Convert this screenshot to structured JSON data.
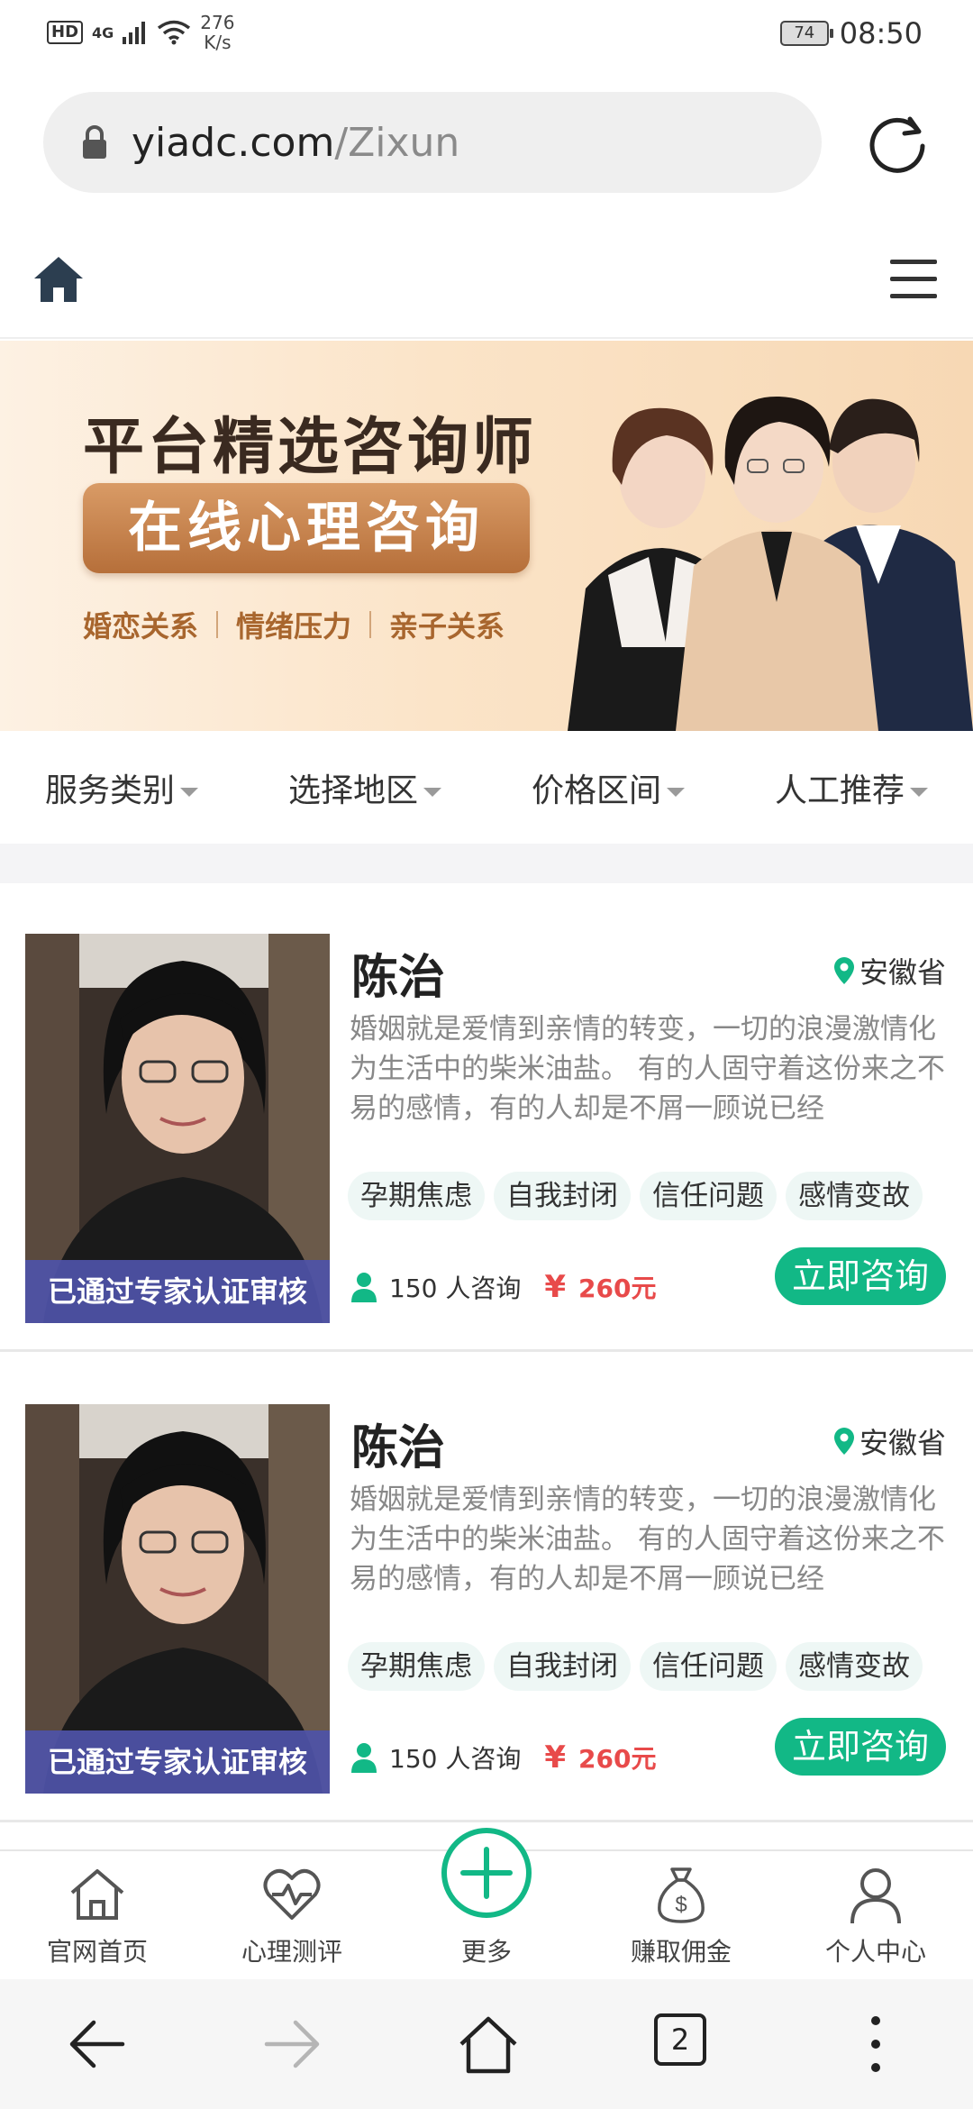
{
  "status_bar": {
    "signal_label": "HD",
    "network": "4G",
    "speed_value": "276",
    "speed_unit": "K/s",
    "battery": "74",
    "time": "08:50"
  },
  "browser": {
    "url_domain": "yiadc.com",
    "url_path": "/Zixun"
  },
  "banner": {
    "title": "平台精选咨询师",
    "subtitle": "在线心理咨询",
    "tags": [
      "婚恋关系",
      "情绪压力",
      "亲子关系"
    ]
  },
  "filters": [
    "服务类别",
    "选择地区",
    "价格区间",
    "人工推荐"
  ],
  "cards": [
    {
      "name": "陈治",
      "location": "安徽省",
      "verified": "已通过专家认证审核",
      "description": "婚姻就是爱情到亲情的转变，一切的浪漫激情化为生活中的柴米油盐。 有的人固守着这份来之不易的感情，有的人却是不屑一顾说已经",
      "tags": [
        "孕期焦虑",
        "自我封闭",
        "信任问题",
        "感情变故"
      ],
      "consult_count": "150 人咨询",
      "price_symbol": "¥",
      "price": "260元",
      "button": "立即咨询"
    },
    {
      "name": "陈治",
      "location": "安徽省",
      "verified": "已通过专家认证审核",
      "description": "婚姻就是爱情到亲情的转变，一切的浪漫激情化为生活中的柴米油盐。 有的人固守着这份来之不易的感情，有的人却是不屑一顾说已经",
      "tags": [
        "孕期焦虑",
        "自我封闭",
        "信任问题",
        "感情变故"
      ],
      "consult_count": "150 人咨询",
      "price_symbol": "¥",
      "price": "260元",
      "button": "立即咨询"
    }
  ],
  "site_nav": [
    {
      "label": "官网首页",
      "icon": "home-icon"
    },
    {
      "label": "心理测评",
      "icon": "heart-pulse-icon"
    },
    {
      "label": "更多",
      "icon": "plus-icon"
    },
    {
      "label": "赚取佣金",
      "icon": "money-bag-icon"
    },
    {
      "label": "个人中心",
      "icon": "user-icon"
    }
  ],
  "browser_nav": {
    "tab_count": "2"
  },
  "colors": {
    "accent": "#12b886",
    "price": "#e84a4a",
    "verified_bg": "#4e52a8"
  }
}
